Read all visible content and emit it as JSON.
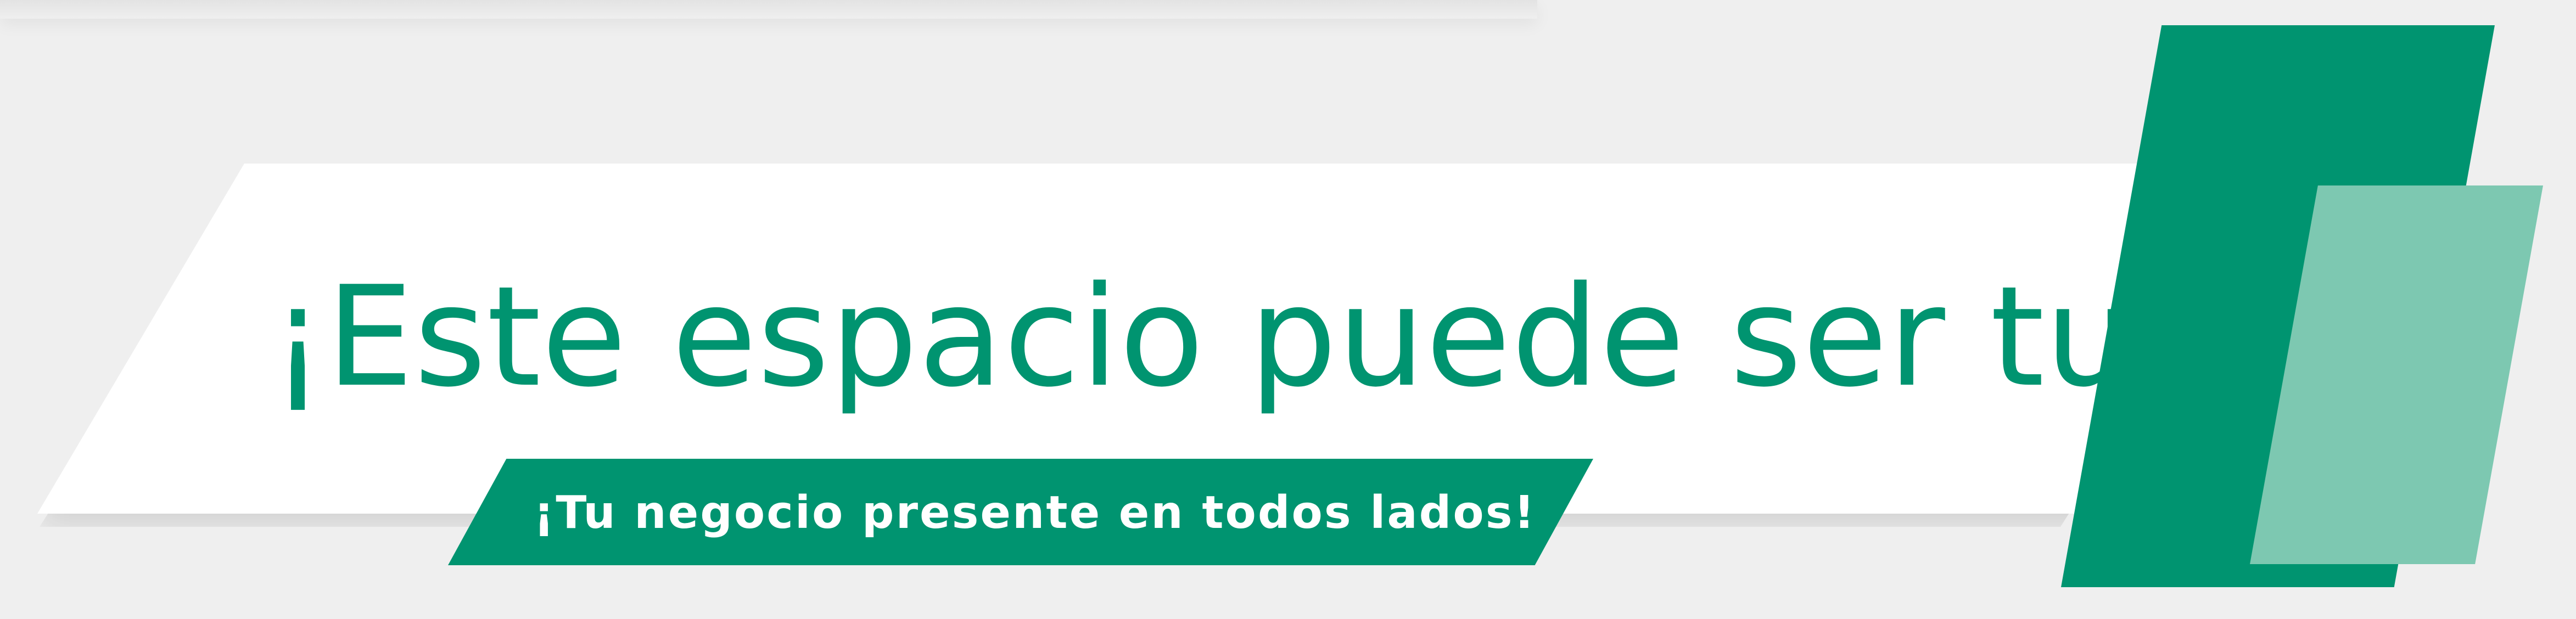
{
  "banner": {
    "headline": "¡Este espacio puede ser tuyo!",
    "subtitle": "¡Tu negocio presente en todos lados!"
  },
  "colors": {
    "primary_green": "#009470",
    "light_green": "#7dc8b1",
    "panel_white": "#ffffff",
    "background_gray": "#efefef"
  }
}
